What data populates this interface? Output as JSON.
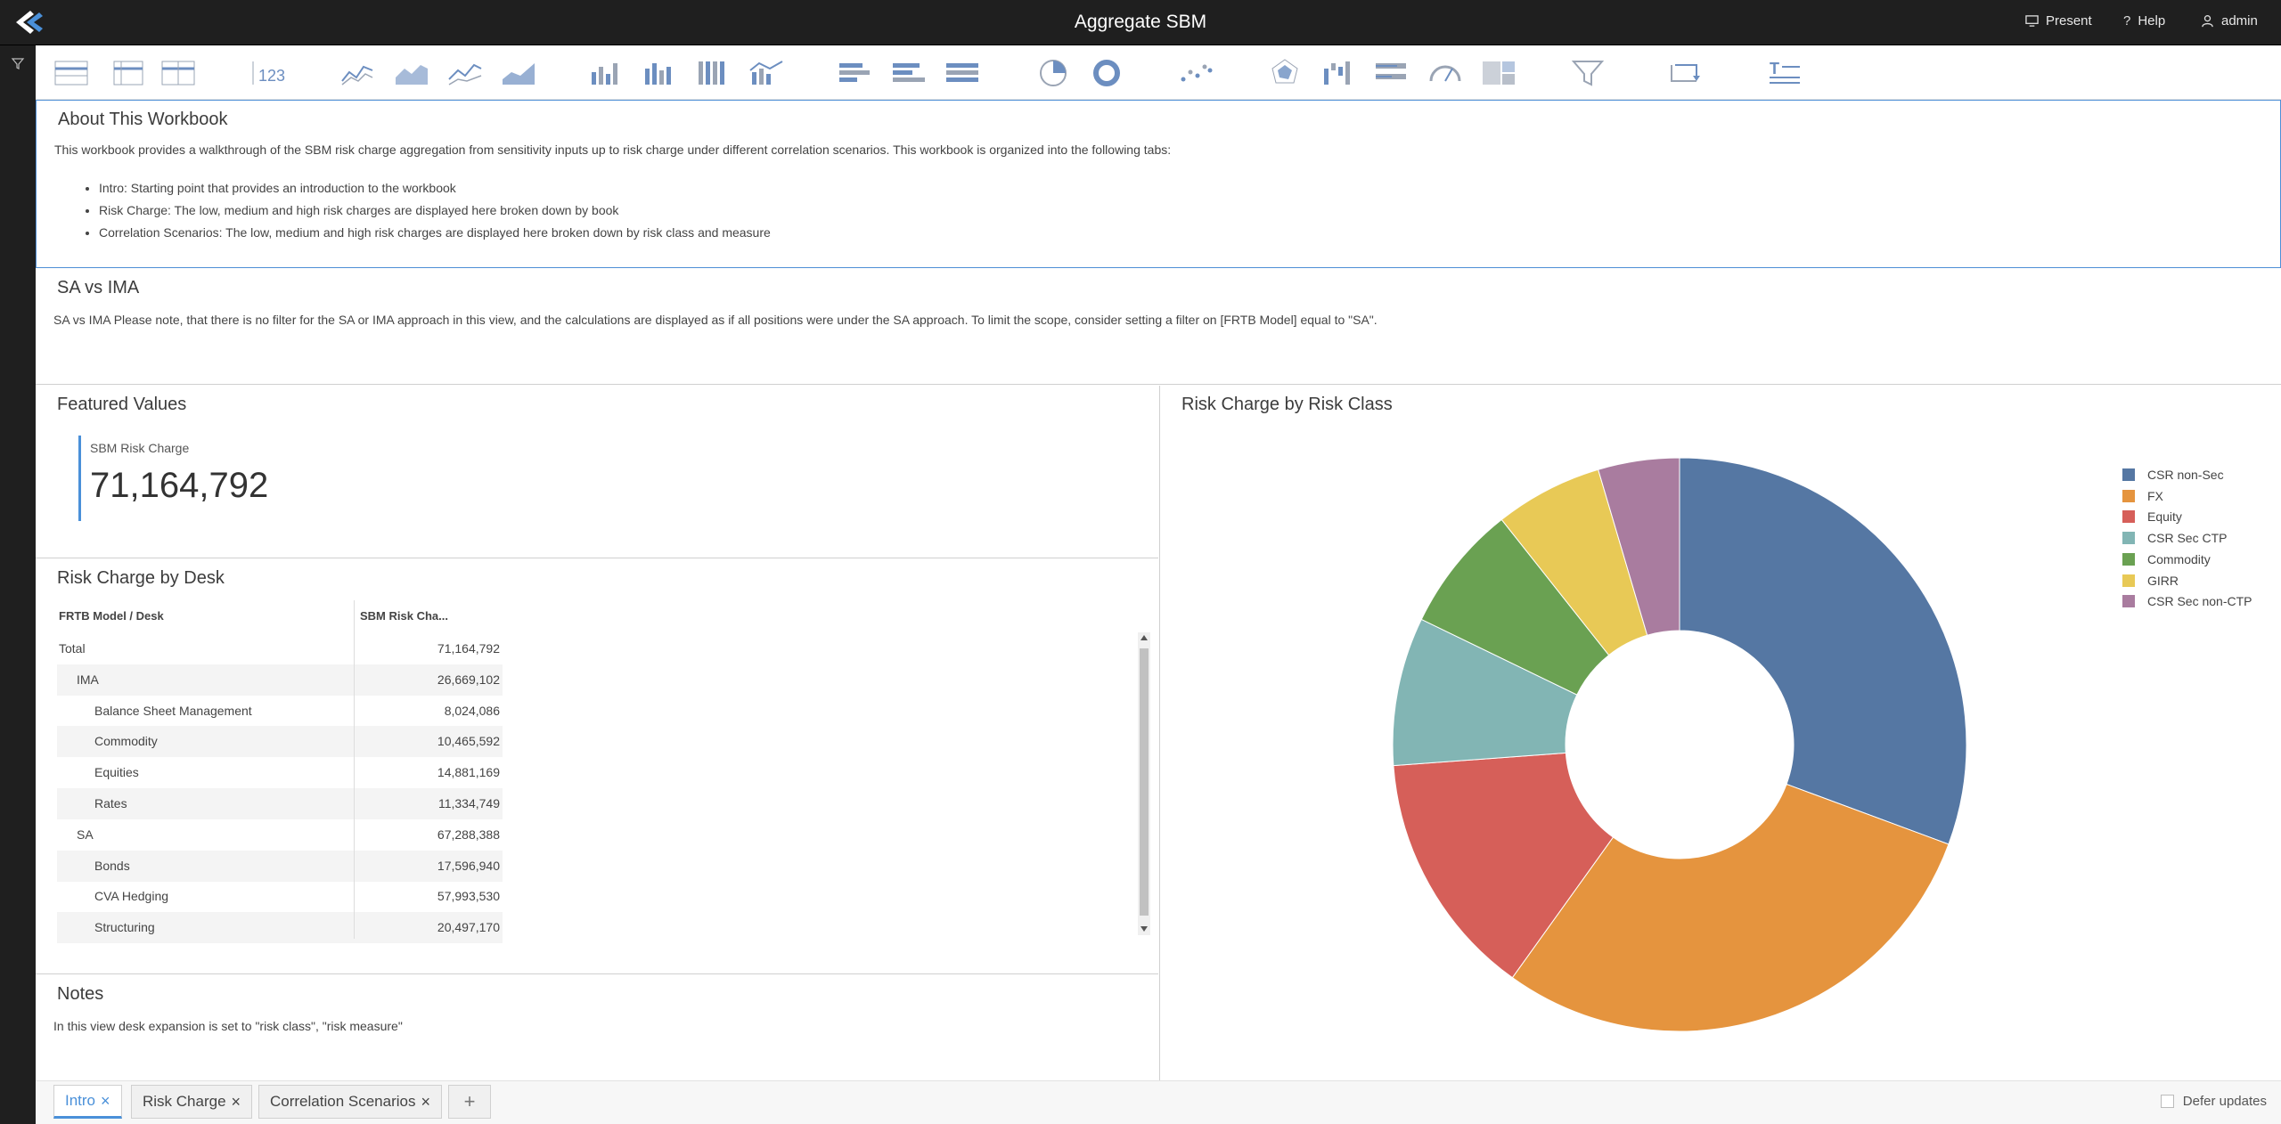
{
  "app": {
    "title": "Aggregate SBM"
  },
  "topbar": {
    "present": "Present",
    "help": "Help",
    "user": "admin"
  },
  "about": {
    "title": "About This Workbook",
    "text": "This workbook provides a walkthrough of the SBM risk charge aggregation from sensitivity inputs up to risk charge under different correlation scenarios. This workbook is organized into the following tabs:",
    "bullets": [
      "Intro: Starting point that provides an introduction to the workbook",
      "Risk Charge: The low, medium and high risk charges are displayed here broken down by book",
      "Correlation Scenarios: The low, medium and high risk charges are displayed here broken down by risk class and measure"
    ]
  },
  "savsima": {
    "title": "SA vs IMA",
    "text": "SA vs IMA Please note, that there is no filter for the SA or IMA approach in this view, and the calculations are displayed as if all positions were under the SA approach. To limit the scope, consider setting a filter on [FRTB Model] equal to \"SA\"."
  },
  "featured": {
    "title": "Featured Values",
    "kpi_label": "SBM Risk Charge",
    "kpi_value": "71,164,792"
  },
  "desk": {
    "title": "Risk Charge by Desk",
    "col1": "FRTB Model / Desk",
    "col2": "SBM Risk Cha...",
    "rows": [
      {
        "label": "Total",
        "value": "71,164,792",
        "level": 0
      },
      {
        "label": "IMA",
        "value": "26,669,102",
        "level": 1
      },
      {
        "label": "Balance Sheet Management",
        "value": "8,024,086",
        "level": 2
      },
      {
        "label": "Commodity",
        "value": "10,465,592",
        "level": 2
      },
      {
        "label": "Equities",
        "value": "14,881,169",
        "level": 2
      },
      {
        "label": "Rates",
        "value": "11,334,749",
        "level": 2
      },
      {
        "label": "SA",
        "value": "67,288,388",
        "level": 1
      },
      {
        "label": "Bonds",
        "value": "17,596,940",
        "level": 2
      },
      {
        "label": "CVA Hedging",
        "value": "57,993,530",
        "level": 2
      },
      {
        "label": "Structuring",
        "value": "20,497,170",
        "level": 2
      }
    ]
  },
  "notes": {
    "title": "Notes",
    "text": "In this view desk expansion is set to \"risk class\", \"risk measure\""
  },
  "chart_data": {
    "type": "pie",
    "title": "Risk Charge by Risk Class",
    "categories": [
      "CSR non-Sec",
      "FX",
      "Equity",
      "CSR Sec CTP",
      "Commodity",
      "GIRR",
      "CSR Sec non-CTP"
    ],
    "values": [
      30.8,
      29.4,
      14.0,
      8.4,
      7.2,
      6.1,
      4.6
    ],
    "colors": [
      "#5577a3",
      "#e5943e",
      "#d65f59",
      "#82b5b4",
      "#6aa152",
      "#e8c956",
      "#a97c9f"
    ],
    "legend": "right"
  },
  "tabs": [
    {
      "label": "Intro",
      "active": true
    },
    {
      "label": "Risk Charge",
      "active": false
    },
    {
      "label": "Correlation Scenarios",
      "active": false
    }
  ],
  "add_tab": "+",
  "defer": "Defer updates",
  "toolbar_icons": [
    "table-icon",
    "pivot-table-icon",
    "tabular-icon",
    "kpi-icon",
    "line-chart-icon",
    "area-chart-icon",
    "stacked-line-icon",
    "stacked-area-icon",
    "column-chart-icon",
    "stacked-column-icon",
    "full-column-icon",
    "combo-chart-icon",
    "bar-chart-icon",
    "stacked-bar-icon",
    "full-bar-icon",
    "pie-chart-icon",
    "donut-chart-icon",
    "scatter-icon",
    "radar-icon",
    "waterfall-icon",
    "bullet-icon",
    "gauge-icon",
    "treemap-icon",
    "filter-icon",
    "drilldown-icon",
    "text-editor-icon"
  ]
}
